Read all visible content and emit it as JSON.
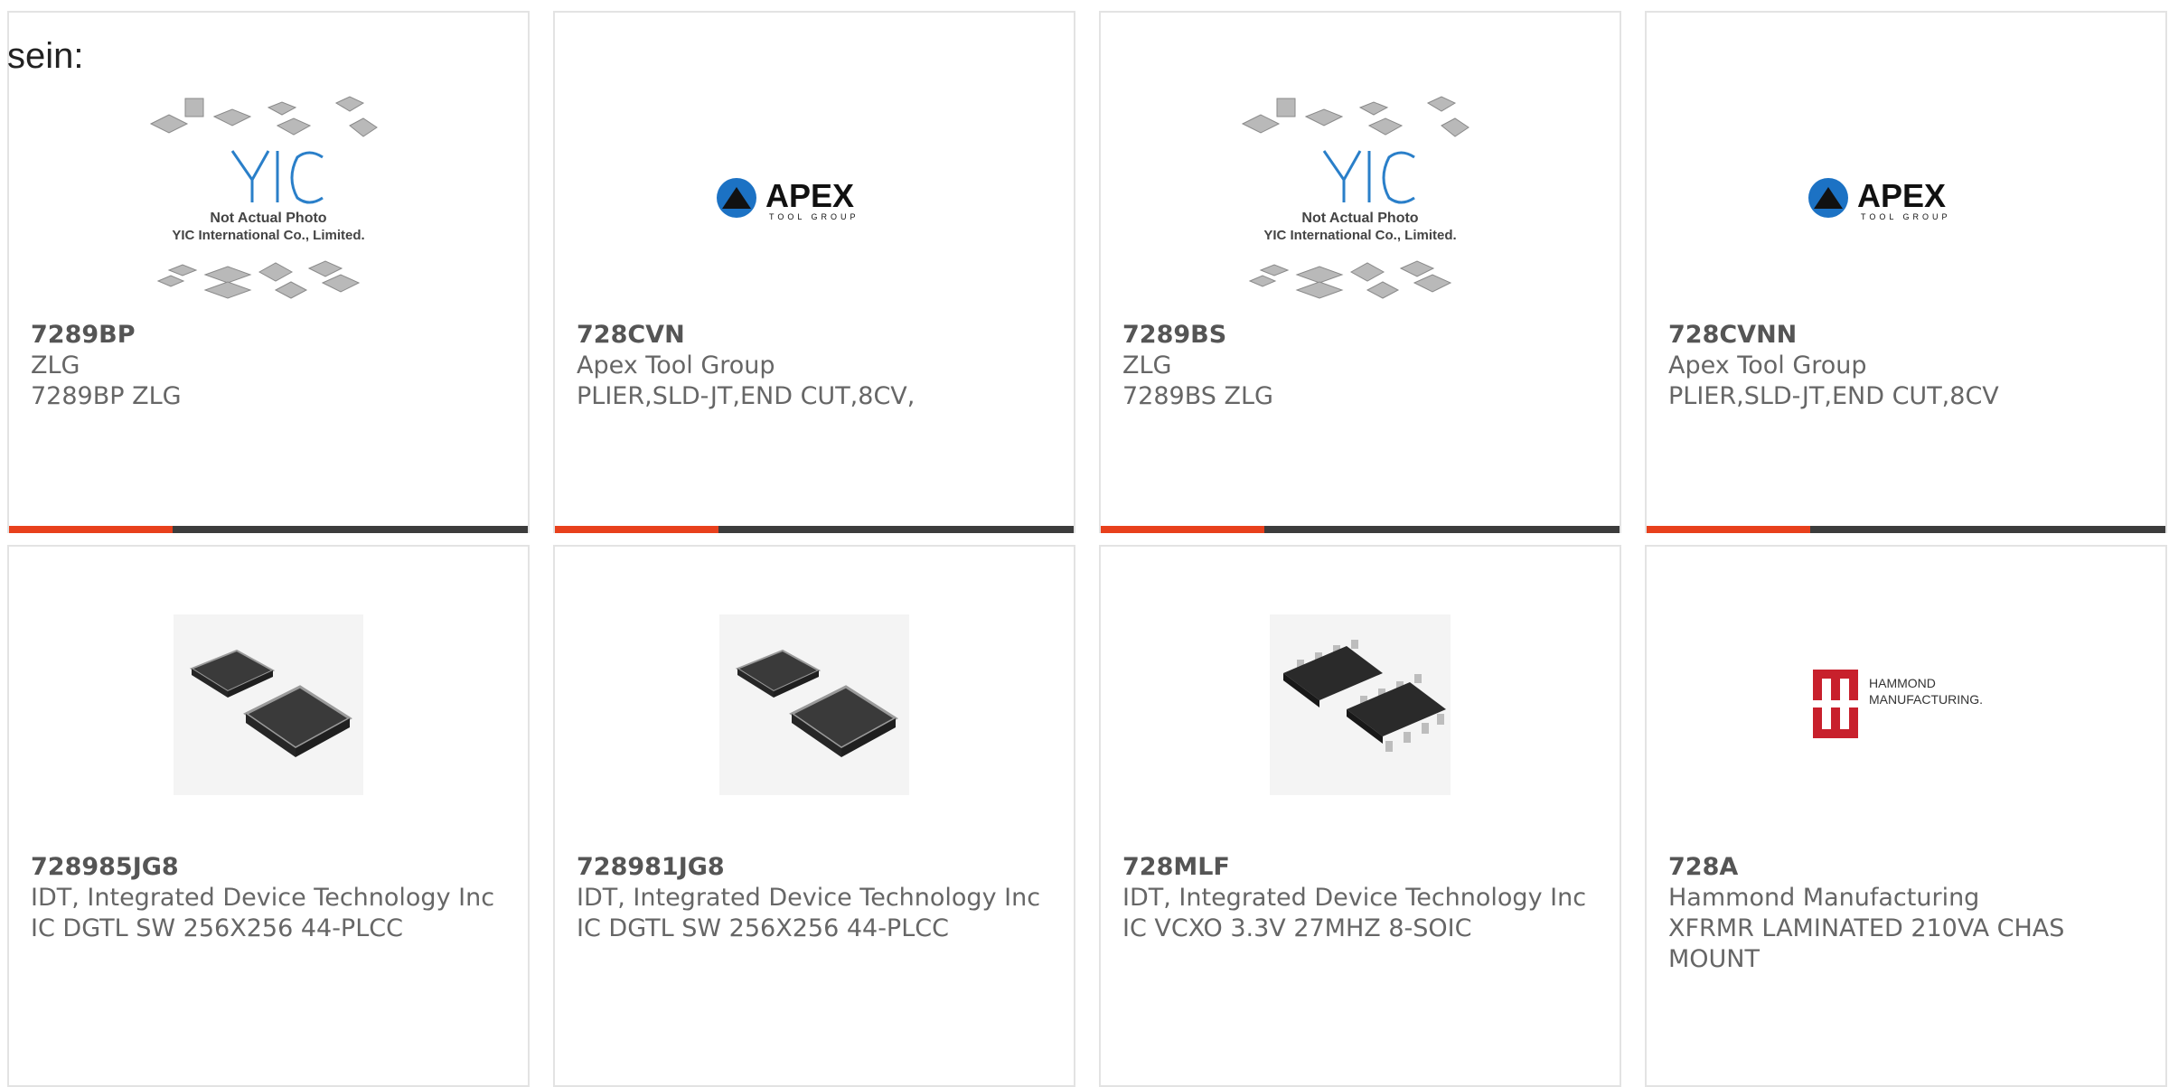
{
  "intro_text": "sein:",
  "products": [
    {
      "part": "7289BP",
      "maker": "ZLG",
      "desc": "7289BP ZLG",
      "image": "yic-not-actual-photo"
    },
    {
      "part": "728CVN",
      "maker": "Apex Tool Group",
      "desc": "PLIER,SLD-JT,END CUT,8CV,",
      "image": "apex-tool-group-logo"
    },
    {
      "part": "7289BS",
      "maker": "ZLG",
      "desc": "7289BS ZLG",
      "image": "yic-not-actual-photo"
    },
    {
      "part": "728CVNN",
      "maker": "Apex Tool Group",
      "desc": "PLIER,SLD-JT,END CUT,8CV",
      "image": "apex-tool-group-logo"
    },
    {
      "part": "728985JG8",
      "maker": "IDT, Integrated Device Technology Inc",
      "desc": "IC DGTL SW 256X256 44-PLCC",
      "image": "plcc-chip-photo"
    },
    {
      "part": "728981JG8",
      "maker": "IDT, Integrated Device Technology Inc",
      "desc": "IC DGTL SW 256X256 44-PLCC",
      "image": "plcc-chip-photo"
    },
    {
      "part": "728MLF",
      "maker": "IDT, Integrated Device Technology Inc",
      "desc": "IC VCXO 3.3V 27MHZ 8-SOIC",
      "image": "soic-chip-photo"
    },
    {
      "part": "728A",
      "maker": "Hammond Manufacturing",
      "desc": "XFRMR LAMINATED 210VA CHAS MOUNT",
      "image": "hammond-manufacturing-logo"
    }
  ],
  "yic_placeholder": {
    "line1": "Not Actual Photo",
    "line2": "YIC International Co., Limited."
  },
  "apex_logo": {
    "name": "APEX",
    "sub": "TOOL GROUP"
  },
  "hammond_logo": {
    "line1": "HAMMOND",
    "line2": "MANUFACTURING."
  },
  "colors": {
    "accent": "#e8401c",
    "bar": "#3c3c3c",
    "border": "#e3e3e3"
  }
}
